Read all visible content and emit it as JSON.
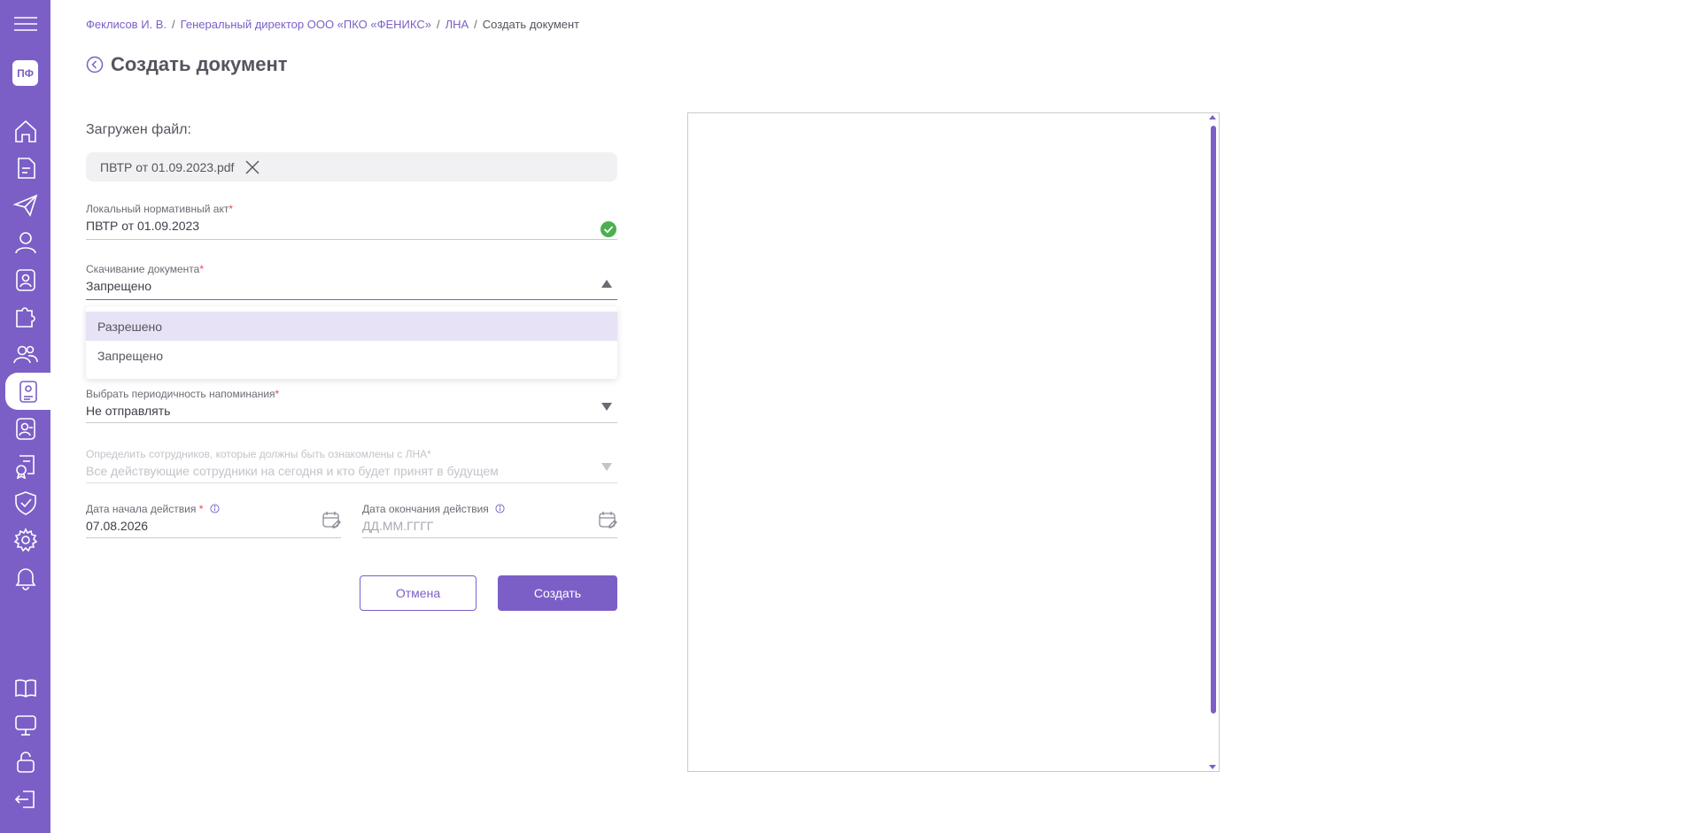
{
  "sidebar": {
    "logo": "ПФ",
    "icons": [
      "menu-icon",
      "home-icon",
      "document-icon",
      "paper-plane-icon",
      "user-icon",
      "badge-icon",
      "puzzle-icon",
      "team-icon",
      "lna-book-icon",
      "user-card-icon",
      "certificate-icon",
      "shield-check-icon",
      "gear-icon",
      "bell-icon",
      "open-book-icon",
      "presentation-icon",
      "unlock-icon",
      "logout-icon"
    ]
  },
  "breadcrumb": {
    "items": [
      "Феклисов И. В.",
      "Генеральный директор ООО «ПКО «ФЕНИКС»",
      "ЛНА"
    ],
    "current": "Создать документ",
    "sep": "/"
  },
  "header": {
    "title": "Создать документ"
  },
  "upload": {
    "label": "Загружен файл:",
    "filename": "ПВТР от 01.09.2023.pdf"
  },
  "form": {
    "lna": {
      "label": "Локальный нормативный акт",
      "value": "ПВТР от 01.09.2023"
    },
    "download": {
      "label": "Скачивание документа",
      "value": "Запрещено",
      "options": [
        "Разрешено",
        "Запрещено"
      ]
    },
    "reminder": {
      "label": "Выбрать периодичность напоминания",
      "value": "Не отправлять"
    },
    "employees": {
      "label": "Определить сотрудников, которые должны быть ознакомлены с ЛНА",
      "value": "Все действующие сотрудники на сегодня и кто будет принят в будущем"
    },
    "start_date": {
      "label": "Дата начала действия",
      "value": "07.08.2026"
    },
    "end_date": {
      "label": "Дата окончания действия",
      "placeholder": "ДД.ММ.ГГГГ"
    },
    "required_mark": "*"
  },
  "buttons": {
    "cancel": "Отмена",
    "create": "Создать"
  },
  "colors": {
    "accent": "#7b5fc7",
    "success": "#4caf50",
    "required": "#e5484d"
  }
}
